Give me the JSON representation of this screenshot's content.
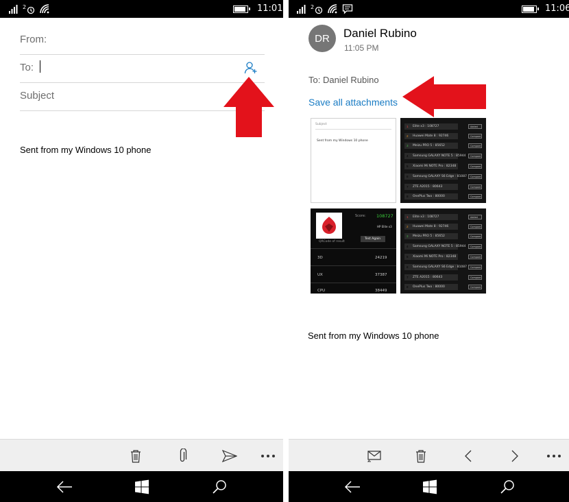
{
  "left_screen": {
    "status": {
      "time": "11:01"
    },
    "compose": {
      "from_label": "From:",
      "to_label": "To:",
      "subject_placeholder": "Subject",
      "signature": "Sent from my Windows 10 phone"
    }
  },
  "right_screen": {
    "status": {
      "time": "11:06"
    },
    "message": {
      "avatar_initials": "DR",
      "sender": "Daniel Rubino",
      "time": "11:05 PM",
      "to_line": "To: Daniel Rubino",
      "save_all": "Save all attachments",
      "signature": "Sent from my Windows 10 phone"
    },
    "attachments": {
      "thumb1": {
        "subject": "Subject",
        "body": "Sent from my Windows 10 phone"
      },
      "ranking": {
        "rows": [
          {
            "rank": "1",
            "text": "Elite x3 : 108727"
          },
          {
            "rank": "2",
            "text": "Huawei Mate 8 : 92746"
          },
          {
            "rank": "3",
            "text": "Meizu PRO 5 : 85652"
          },
          {
            "rank": "4",
            "text": "Samsung GALAXY NOTE 5 : 85944"
          },
          {
            "rank": "5",
            "text": "Xiaomi Mi NOTE Pro : 82348"
          },
          {
            "rank": "6",
            "text": "Samsung GALAXY S6 Edge : 81087"
          },
          {
            "rank": "7",
            "text": "ZTE A2015 : 80643"
          },
          {
            "rank": "8",
            "text": "OnePlus Two : 80000"
          }
        ],
        "button_first": "Added",
        "button_other": "Compare"
      },
      "antutu": {
        "score_label": "Score:",
        "score": "108727",
        "device": "HP Elite x3",
        "qr_caption": "QRCode of result",
        "test_again": "Test Again",
        "rows": [
          {
            "name": "3D",
            "value": "24219"
          },
          {
            "name": "UX",
            "value": "37387"
          },
          {
            "name": "CPU",
            "value": "38449"
          }
        ]
      }
    }
  },
  "colors": {
    "accent": "#1a7cc4",
    "arrow": "#e3121b",
    "avatar": "#767676",
    "appbar": "#efefef"
  }
}
